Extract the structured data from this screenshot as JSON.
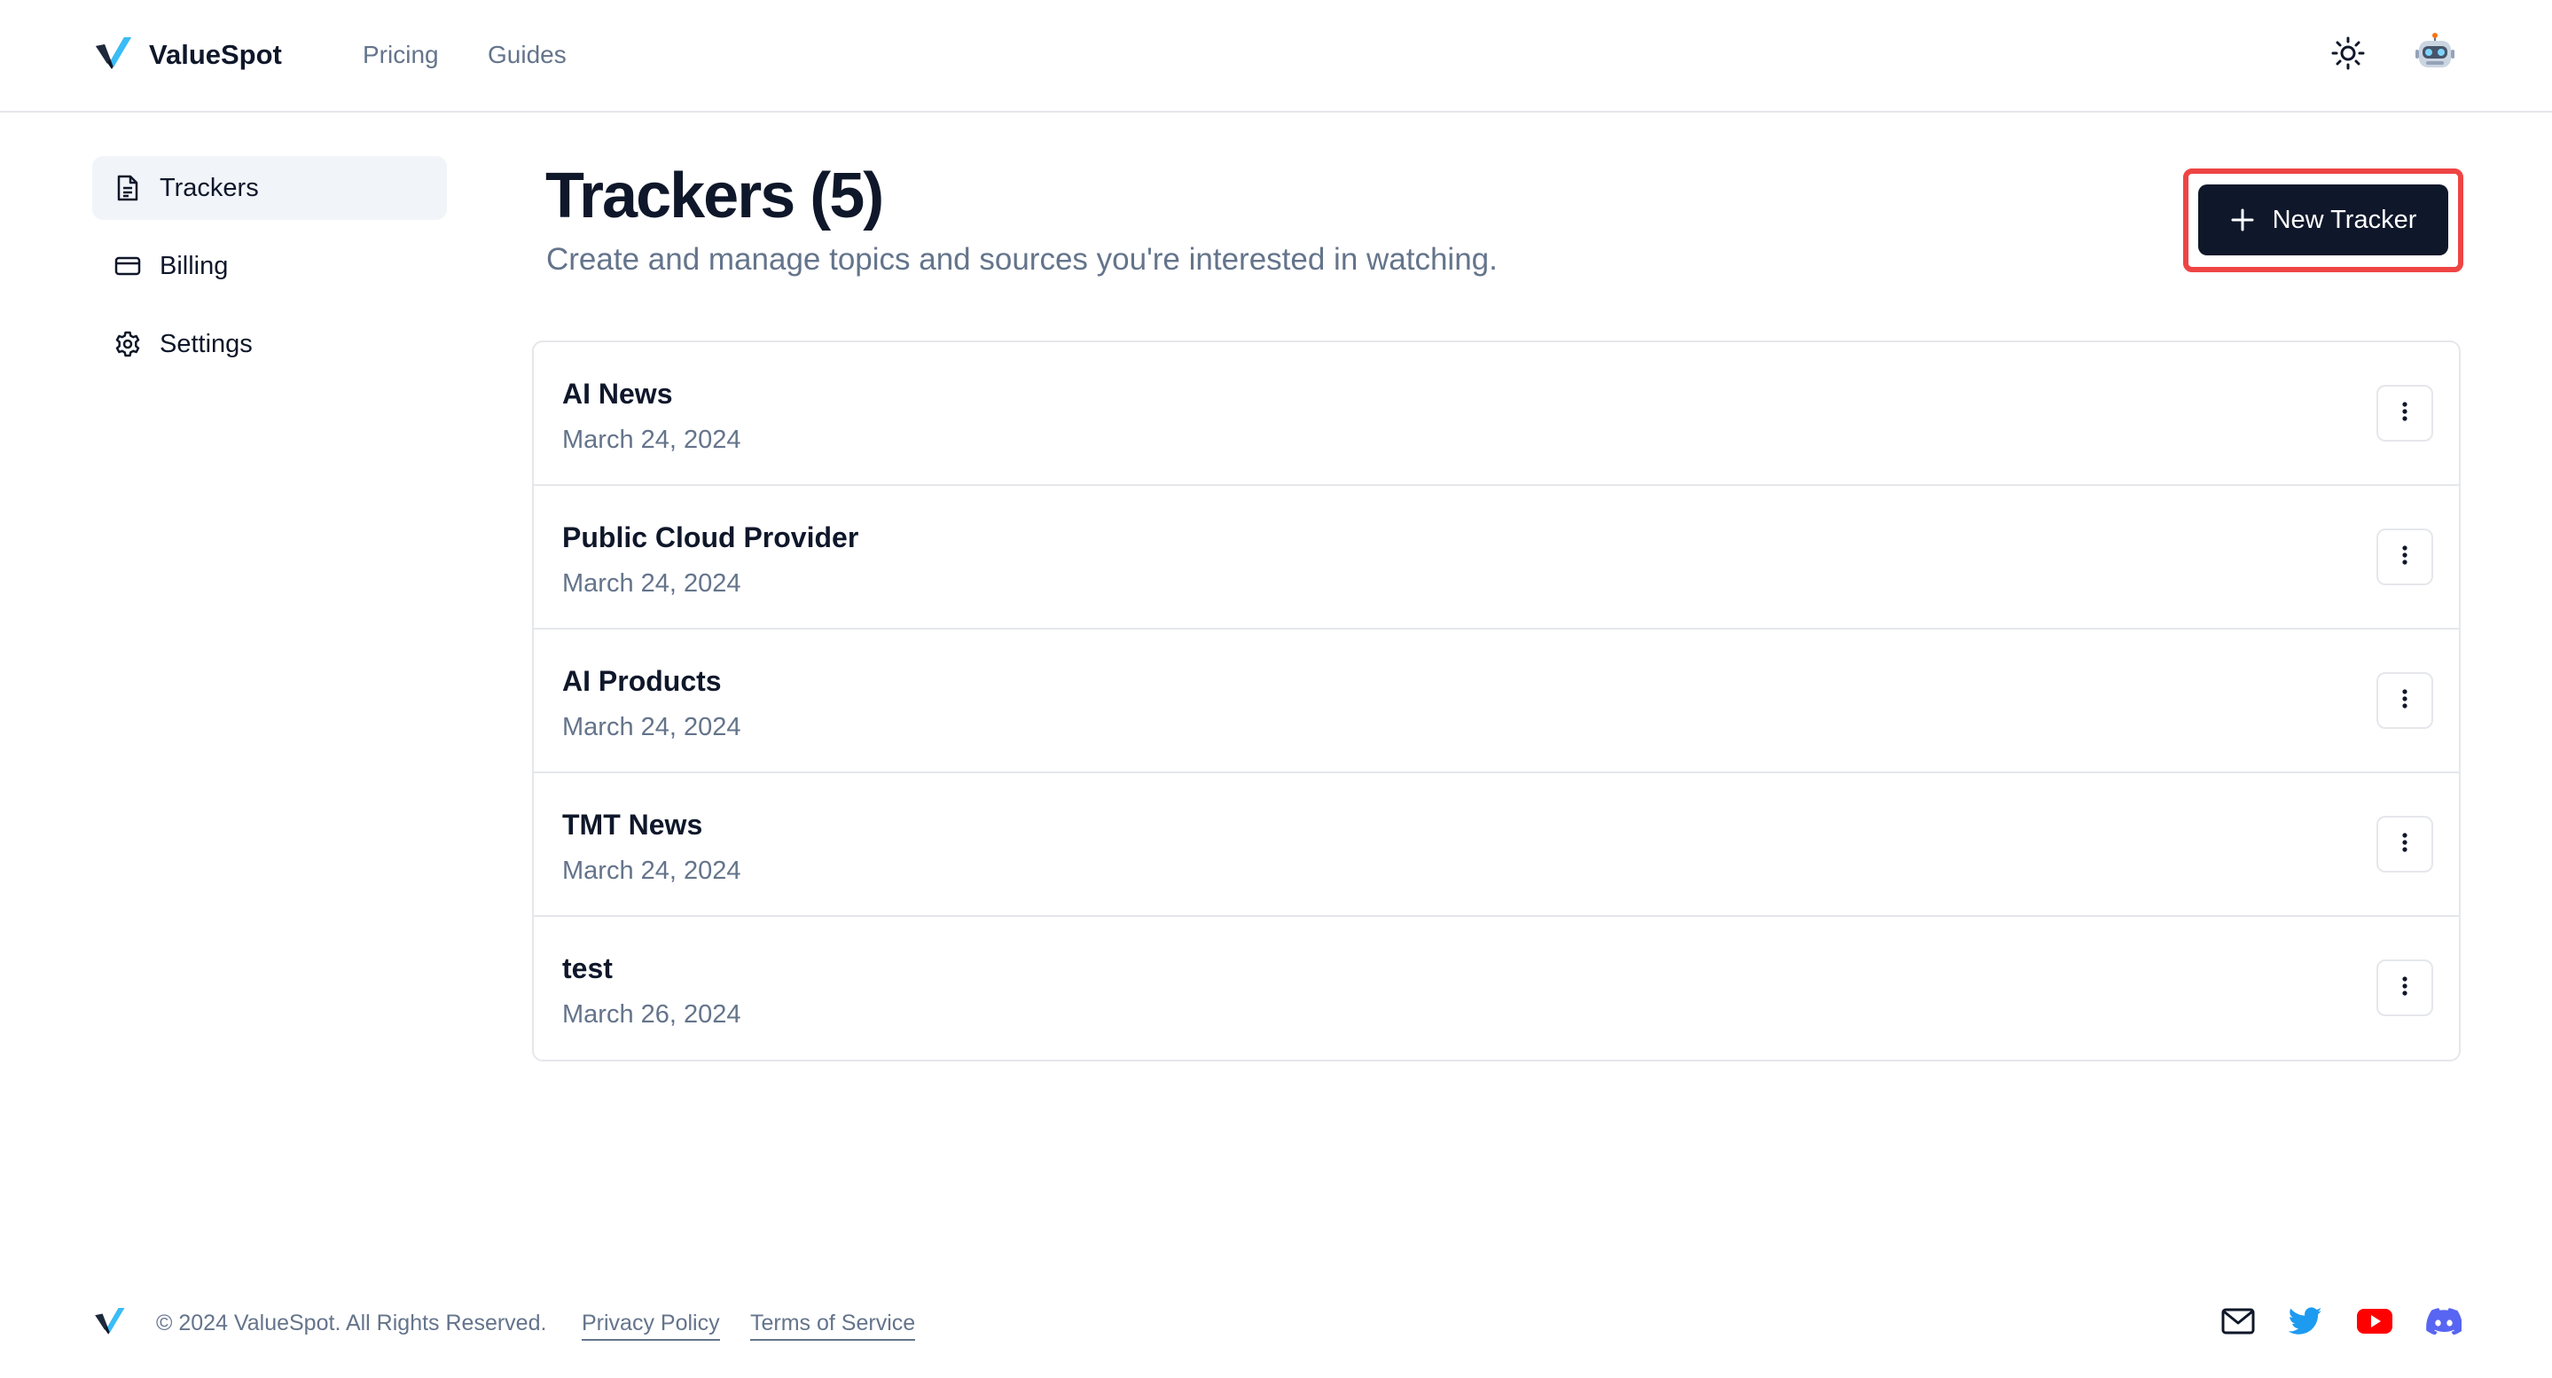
{
  "header": {
    "brand": "ValueSpot",
    "nav": [
      {
        "label": "Pricing"
      },
      {
        "label": "Guides"
      }
    ]
  },
  "sidebar": {
    "items": [
      {
        "label": "Trackers",
        "icon": "document-icon",
        "active": true
      },
      {
        "label": "Billing",
        "icon": "credit-card-icon",
        "active": false
      },
      {
        "label": "Settings",
        "icon": "gear-icon",
        "active": false
      }
    ]
  },
  "main": {
    "title": "Trackers (5)",
    "subtitle": "Create and manage topics and sources you're interested in watching.",
    "new_button_label": "New Tracker",
    "trackers": [
      {
        "name": "AI News",
        "date": "March 24, 2024"
      },
      {
        "name": "Public Cloud Provider",
        "date": "March 24, 2024"
      },
      {
        "name": "AI Products",
        "date": "March 24, 2024"
      },
      {
        "name": "TMT News",
        "date": "March 24, 2024"
      },
      {
        "name": "test",
        "date": "March 26, 2024"
      }
    ]
  },
  "footer": {
    "copyright": "© 2024 ValueSpot. All Rights Reserved.",
    "privacy": "Privacy Policy",
    "terms": "Terms of Service"
  },
  "colors": {
    "primary": "#0f172a",
    "muted_text": "#64748b",
    "border": "#e5e7eb",
    "highlight": "#ef4444",
    "twitter": "#1d9bf0",
    "youtube": "#ff0000",
    "discord": "#5865f2"
  }
}
